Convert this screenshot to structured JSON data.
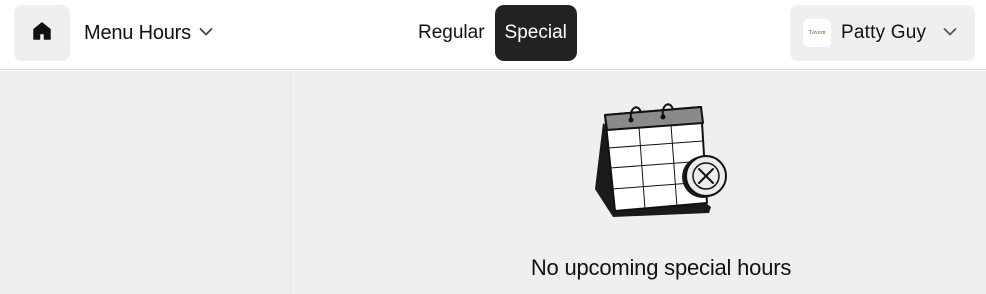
{
  "header": {
    "page_menu_label": "Menu Hours",
    "tabs": [
      {
        "label": "Regular",
        "active": false
      },
      {
        "label": "Special",
        "active": true
      }
    ],
    "account": {
      "name": "Patty Guy",
      "logo_text": "Tāvern"
    }
  },
  "main": {
    "empty_message": "No upcoming special hours"
  },
  "icons": {
    "home": "home-icon",
    "page_menu": "chevron-down-icon",
    "account": "chevron-down-icon",
    "illustration": "calendar-cancel-illustration"
  },
  "colors": {
    "active_tab_bg": "#222222",
    "pane_bg": "#efefef"
  }
}
